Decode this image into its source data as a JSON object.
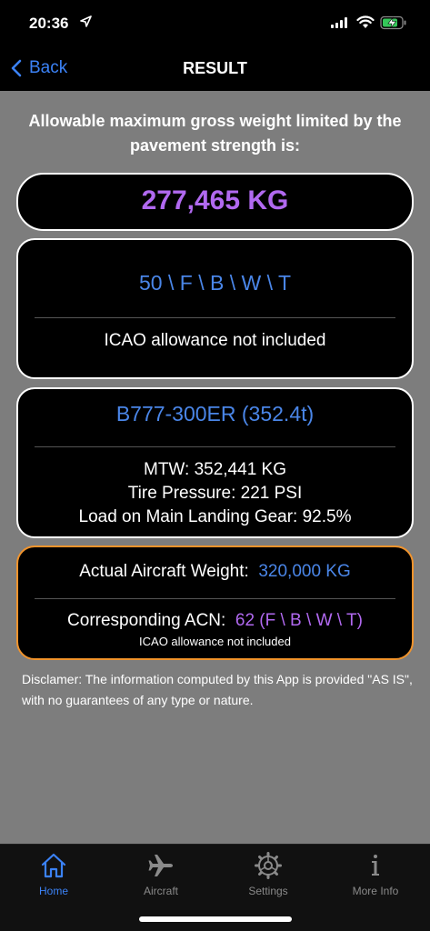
{
  "status": {
    "time": "20:36"
  },
  "nav": {
    "back_label": "Back",
    "title": "RESULT"
  },
  "headline": "Allowable maximum gross weight limited by the pavement strength is:",
  "result": {
    "weight": "277,465 KG"
  },
  "pcn": {
    "code": "50 \\ F \\ B \\ W \\ T",
    "note": "ICAO allowance not included"
  },
  "aircraft": {
    "name": "B777-300ER (352.4t)",
    "mtw": "MTW: 352,441 KG",
    "tire": "Tire Pressure: 221 PSI",
    "load": "Load on Main Landing Gear: 92.5%"
  },
  "actual": {
    "weight_label": "Actual Aircraft Weight:",
    "weight_value": "320,000 KG",
    "acn_label": "Corresponding ACN:",
    "acn_value": "62 (F \\ B \\ W \\ T)",
    "note": "ICAO allowance not included"
  },
  "disclaimer": "Disclamer: The information computed by this App is provided \"AS IS\", with no guarantees of any type or nature.",
  "tabs": [
    {
      "label": "Home",
      "icon": "home-icon",
      "active": true
    },
    {
      "label": "Aircraft",
      "icon": "airplane-icon",
      "active": false
    },
    {
      "label": "Settings",
      "icon": "gear-icon",
      "active": false
    },
    {
      "label": "More Info",
      "icon": "info-icon",
      "active": false
    }
  ],
  "colors": {
    "accent": "#4a86e8",
    "highlight": "#b169f0",
    "orange": "#f0932c"
  }
}
